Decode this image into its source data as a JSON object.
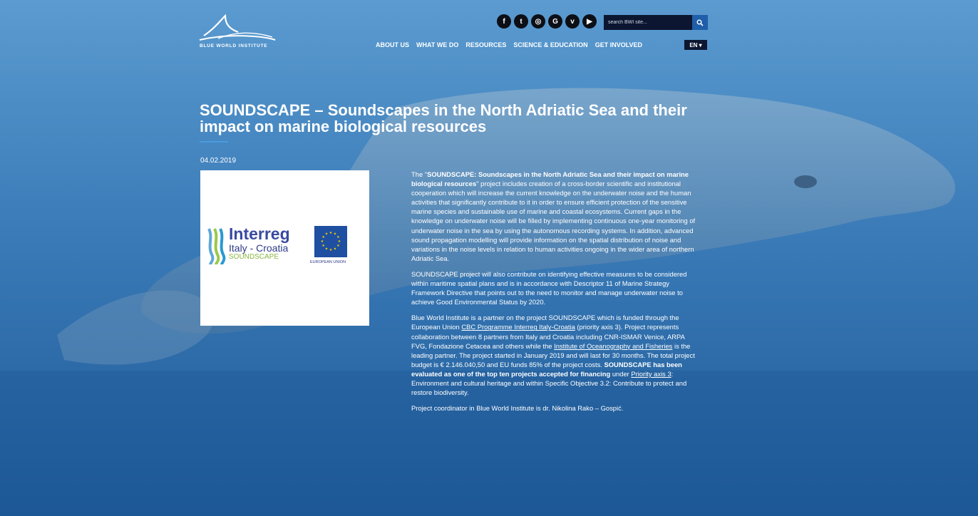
{
  "site": {
    "logo_text": "BLUE WORLD INSTITUTE",
    "social_icons": [
      {
        "name": "facebook-icon",
        "glyph": "f"
      },
      {
        "name": "twitter-icon",
        "glyph": "t"
      },
      {
        "name": "instagram-icon",
        "glyph": "◎"
      },
      {
        "name": "google-icon",
        "glyph": "G"
      },
      {
        "name": "vimeo-icon",
        "glyph": "v"
      },
      {
        "name": "youtube-icon",
        "glyph": "▶"
      }
    ],
    "search_placeholder": "search BWI site...",
    "nav": [
      "ABOUT US",
      "WHAT WE DO",
      "RESOURCES",
      "SCIENCE & EDUCATION",
      "GET INVOLVED"
    ],
    "language": "EN ▾"
  },
  "article": {
    "title": "SOUNDSCAPE – Soundscapes in the North Adriatic Sea and their impact on marine biological resources",
    "date": "04.02.2019",
    "image": {
      "brand": "interreg",
      "brand_display": "Interreg",
      "programme": "Italy - Croatia",
      "project": "SOUNDSCAPE",
      "eu_label": "EUROPEAN UNION"
    },
    "p1": {
      "a": "The \"",
      "b": "SOUNDSCAPE: Soundscapes in the North Adriatic Sea and their impact on marine biological resources",
      "c": "\" project includes creation of a cross-border scientific and institutional cooperation which will increase the current knowledge on the underwater noise and the human activities that significantly contribute to it in order to ensure efficient protection of the sensitive marine species and sustainable use of marine and coastal ecosystems. Current gaps in the knowledge on underwater noise will be filled by implementing continuous one-year monitoring of underwater noise in the sea by using the autonomous recording systems. In addition, advanced sound propagation modelling will provide information on the spatial distribution of noise and variations in the noise levels in relation to human activities ongoing in the wider area of northern Adriatic Sea."
    },
    "p2": "SOUNDSCAPE project will also contribute on identifying effective measures to be considered within maritime spatial plans and is in accordance with Descriptor 11 of Marine Strategy Framework Directive that points out to the need to monitor and manage underwater noise to achieve Good Environmental Status by 2020.",
    "p3": {
      "a": "Blue World Institute is a partner on the project SOUNDSCAPE which is funded through the European Union ",
      "link1": "CBC Programme Interreg Italy-Croatia",
      "b": " (priority axis 3). Project represents collaboration between 8 partners from Italy and Croatia including CNR-ISMAR Venice, ARPA FVG, Fondazione Cetacea and others while the ",
      "link2": "Institute of Oceanography and Fisheries",
      "c": " is the leading partner. The project started in January 2019 and will last for 30 months. The total project budget is € 2.146.040,50 and EU funds 85% of the project costs. ",
      "bold": "SOUNDSCAPE has been evaluated as one of the top ten projects accepted for financing",
      "d": " under ",
      "link3": "Priority axis 3",
      "e": ": Environment and cultural heritage and within Specific Objective 3.2: Contribute to protect and restore biodiversity."
    },
    "p4": "Project coordinator in Blue World Institute is dr. Nikolina Rako – Gospić."
  },
  "colors": {
    "bg_top": "#4f8fc8",
    "bg_bottom": "#1f5b99",
    "dark_ui": "#0c1630",
    "accent": "#4a9be0"
  }
}
